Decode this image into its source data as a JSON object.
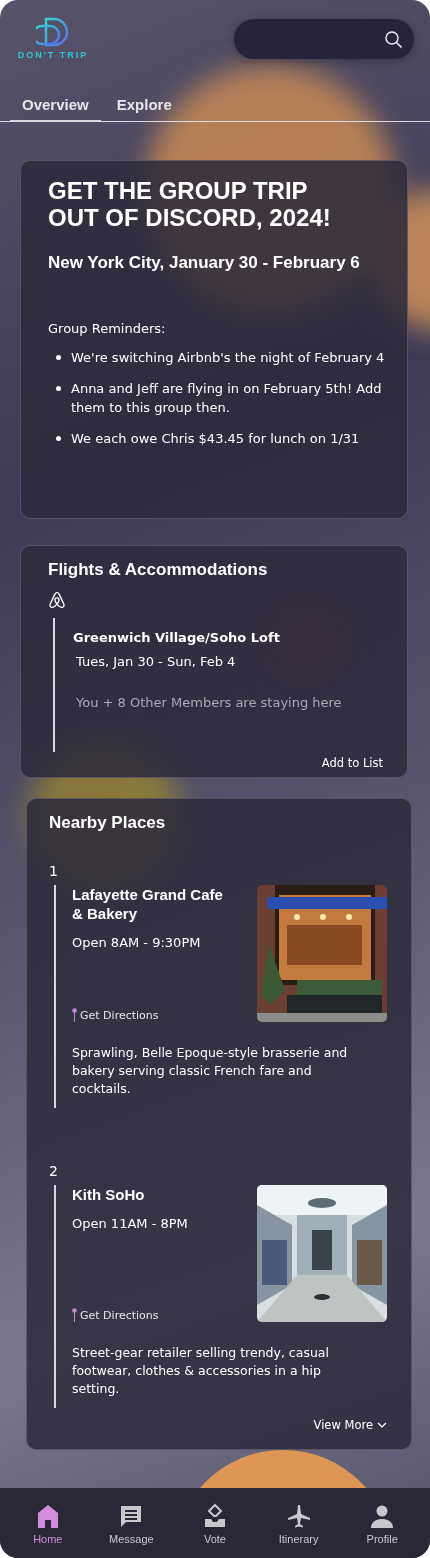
{
  "header": {
    "logo_text": "DON'T TRIP"
  },
  "tabs": [
    {
      "label": "Overview",
      "selected": true
    },
    {
      "label": "Explore",
      "selected": false
    }
  ],
  "trip_card": {
    "title": "GET THE GROUP TRIP OUT OF DISCORD, 2024!",
    "subtitle": "New York City, January 30 - February 6",
    "reminders_heading": "Group Reminders:",
    "reminders": [
      "We're switching Airbnb's the night of February 4",
      "Anna and Jeff are flying in on February 5th! Add them to this group then.",
      "We each owe Chris $43.45 for lunch on 1/31"
    ]
  },
  "stay_card": {
    "title": "Flights & Accommodations",
    "name": "Greenwich Village/Soho Loft",
    "dates": "Tues, Jan 30 - Sun, Feb 4",
    "members": "You + 8 Other Members are staying here",
    "action": "Add to List"
  },
  "nearby": {
    "title": "Nearby Places",
    "places": [
      {
        "number": "1",
        "name": "Lafayette Grand Cafe & Bakery",
        "hours": "Open 8AM - 9:30PM",
        "directions": "Get Directions",
        "description": "Sprawling, Belle Epoque-style brasserie and bakery serving classic French fare and cocktails."
      },
      {
        "number": "2",
        "name": "Kith SoHo",
        "hours": "Open 11AM - 8PM",
        "directions": "Get Directions",
        "description": "Street-gear retailer selling trendy, casual footwear, clothes & accessories in a hip setting."
      }
    ],
    "more": "View More"
  },
  "nav": [
    {
      "label": "Home",
      "selected": true
    },
    {
      "label": "Message",
      "selected": false
    },
    {
      "label": "Vote",
      "selected": false
    },
    {
      "label": "Itinerary",
      "selected": false
    },
    {
      "label": "Profile",
      "selected": false
    }
  ]
}
